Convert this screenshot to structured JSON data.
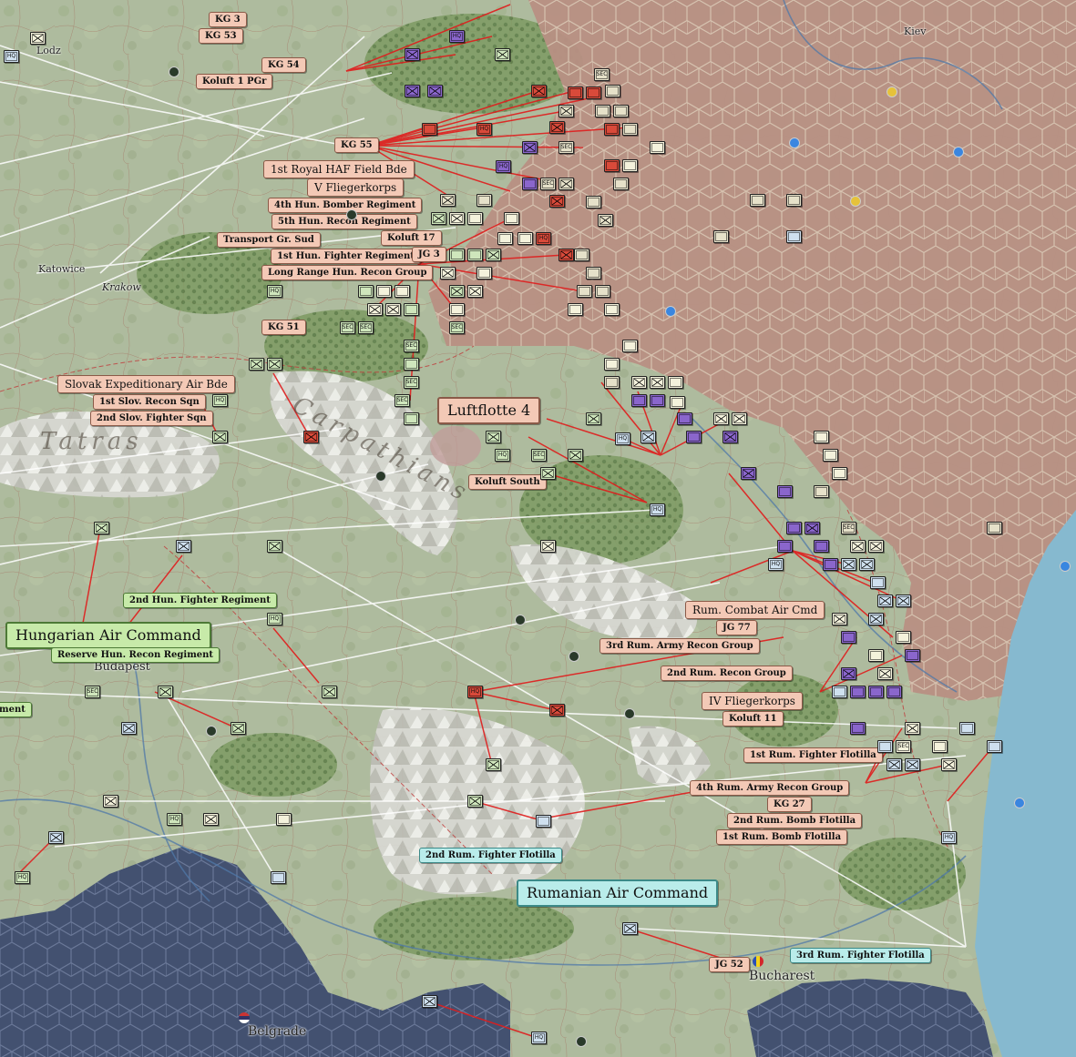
{
  "map": {
    "cities": [
      {
        "name": "Kiev"
      },
      {
        "name": "Lodz"
      },
      {
        "name": "Katowice"
      },
      {
        "name": "Krakow"
      },
      {
        "name": "Budapest"
      },
      {
        "name": "Belgrade"
      },
      {
        "name": "Bucharest"
      }
    ],
    "regions": [
      "Tatras",
      "Carpathians"
    ]
  },
  "hq_labels": {
    "luftflotte4": "Luftflotte 4",
    "hungarian_air_command": "Hungarian Air Command",
    "rumanian_air_command": "Rumanian Air Command"
  },
  "unit_labels": [
    {
      "name": "KG 3",
      "side": "de"
    },
    {
      "name": "KG 53",
      "side": "de"
    },
    {
      "name": "KG 54",
      "side": "de"
    },
    {
      "name": "Koluft 1 PGr",
      "side": "de"
    },
    {
      "name": "KG 55",
      "side": "de"
    },
    {
      "name": "1st Royal HAF Field Bde",
      "side": "de"
    },
    {
      "name": "V Fliegerkorps",
      "side": "de"
    },
    {
      "name": "4th Hun. Bomber Regiment",
      "side": "de"
    },
    {
      "name": "5th Hun. Recon Regiment",
      "side": "de"
    },
    {
      "name": "Transport Gr. Sud",
      "side": "de"
    },
    {
      "name": "Koluft 17",
      "side": "de"
    },
    {
      "name": "1st Hun. Fighter Regiment",
      "side": "de"
    },
    {
      "name": "JG 3",
      "side": "de"
    },
    {
      "name": "Long Range Hun. Recon Group",
      "side": "de"
    },
    {
      "name": "KG 51",
      "side": "de"
    },
    {
      "name": "Slovak Expeditionary Air Bde",
      "side": "de"
    },
    {
      "name": "1st Slov. Recon Sqn",
      "side": "de"
    },
    {
      "name": "2nd Slov. Fighter Sqn",
      "side": "de"
    },
    {
      "name": "Koluft South",
      "side": "de"
    },
    {
      "name": "2nd Hun. Fighter Regiment",
      "side": "hu"
    },
    {
      "name": "Reserve Hun. Recon Regiment",
      "side": "hu"
    },
    {
      "name": "ment",
      "side": "hu"
    },
    {
      "name": "Rum. Combat Air Cmd",
      "side": "de"
    },
    {
      "name": "JG 77",
      "side": "de"
    },
    {
      "name": "3rd Rum. Army Recon Group",
      "side": "de"
    },
    {
      "name": "2nd Rum. Recon Group",
      "side": "de"
    },
    {
      "name": "IV Fliegerkorps",
      "side": "de"
    },
    {
      "name": "Koluft 11",
      "side": "de"
    },
    {
      "name": "1st Rum. Fighter Flotilla",
      "side": "de"
    },
    {
      "name": "4th Rum. Army Recon Group",
      "side": "de"
    },
    {
      "name": "KG 27",
      "side": "de"
    },
    {
      "name": "2nd Rum. Bomb Flotilla",
      "side": "de"
    },
    {
      "name": "1st Rum. Bomb Flotilla",
      "side": "de"
    },
    {
      "name": "2nd Rum. Fighter Flotilla",
      "side": "ro"
    },
    {
      "name": "JG 52",
      "side": "de"
    },
    {
      "name": "3rd Rum. Fighter Flotilla",
      "side": "ro"
    }
  ],
  "counter_codes": {
    "hq": "HQ",
    "sec": "SEC"
  },
  "colors": {
    "german_label": "#f3c9b6",
    "hungarian_label": "#c7eaa9",
    "rumanian_label": "#b9ecea",
    "soviet_hex": "#b88f82",
    "yugoslav_hex": "#424e6e",
    "sea": "#7fb3c9",
    "air_route": "#e02020",
    "transport_route": "#ffffff"
  }
}
